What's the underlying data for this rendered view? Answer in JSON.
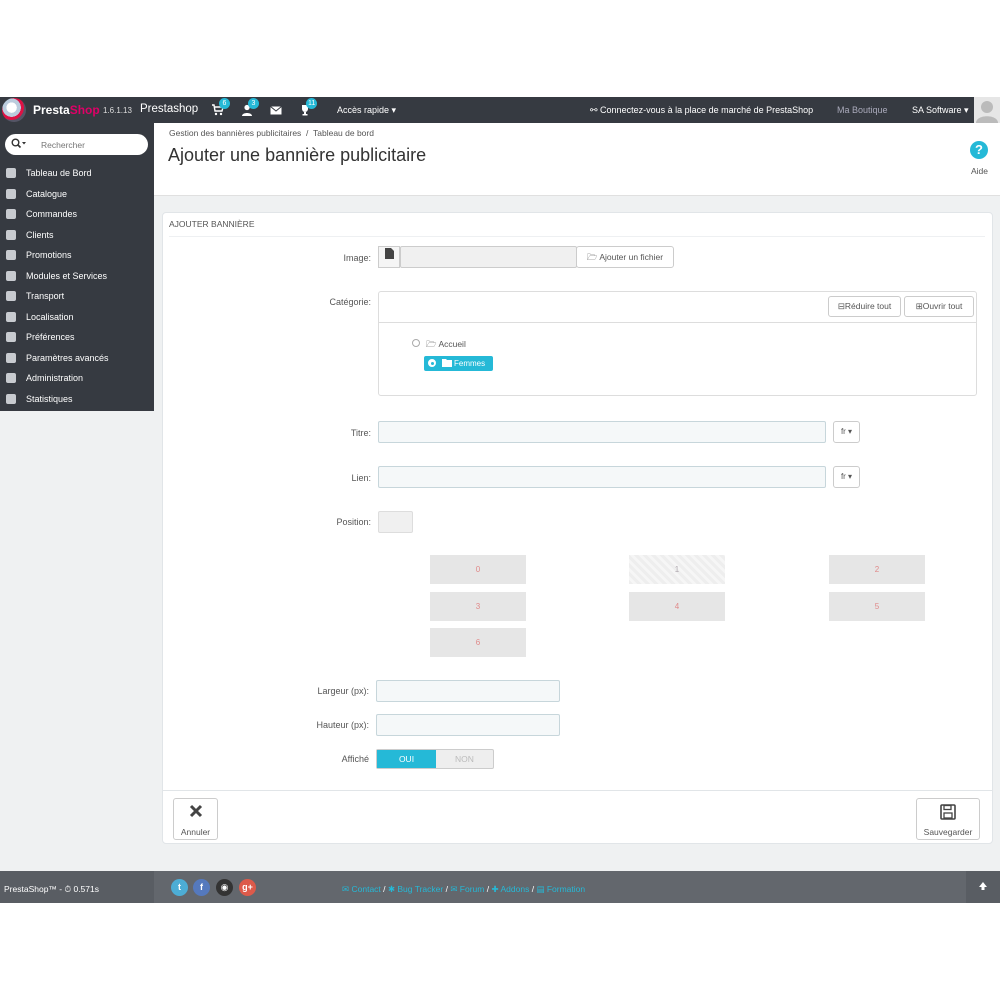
{
  "header": {
    "brand_presta": "Presta",
    "brand_shop": "Shop",
    "version": "1.6.1.13",
    "shop_name": "Prestashop",
    "orders_badge": "6",
    "customers_badge": "3",
    "trophy_badge": "11",
    "quick_access": "Accès rapide ▾",
    "marketplace": "Connectez-vous à la place de marché de PrestaShop",
    "my_shop": "Ma Boutique",
    "user": "SA Software ▾"
  },
  "sidebar": {
    "search_placeholder": "Rechercher",
    "items": [
      {
        "label": "Tableau de Bord"
      },
      {
        "label": "Catalogue"
      },
      {
        "label": "Commandes"
      },
      {
        "label": "Clients"
      },
      {
        "label": "Promotions"
      },
      {
        "label": "Modules et Services"
      },
      {
        "label": "Transport"
      },
      {
        "label": "Localisation"
      },
      {
        "label": "Préférences"
      },
      {
        "label": "Paramètres avancés"
      },
      {
        "label": "Administration"
      },
      {
        "label": "Statistiques"
      }
    ]
  },
  "page": {
    "breadcrumb_1": "Gestion des bannières publicitaires",
    "breadcrumb_sep": "/",
    "breadcrumb_2": "Tableau de bord",
    "title": "Ajouter une bannière publicitaire",
    "help_label": "Aide"
  },
  "form": {
    "panel_title": "AJOUTER BANNIÈRE",
    "image_label": "Image:",
    "add_file": "Ajouter un fichier",
    "category_label": "Catégorie:",
    "collapse_all": "Réduire tout",
    "expand_all": "Ouvrir tout",
    "tree": {
      "root": "Accueil",
      "child": "Femmes"
    },
    "title_label": "Titre:",
    "link_label": "Lien:",
    "lang": "fr ▾",
    "position_label": "Position:",
    "positions": [
      "0",
      "1",
      "2",
      "3",
      "4",
      "5",
      "6"
    ],
    "selected_position": "1",
    "width_label": "Largeur (px):",
    "height_label": "Hauteur (px):",
    "displayed_label": "Affiché",
    "toggle_on": "OUI",
    "toggle_off": "NON",
    "cancel": "Annuler",
    "save": "Sauvegarder"
  },
  "footer": {
    "text": "PrestaShop™ - ⏱ 0.571s",
    "links": [
      "Contact",
      "Bug Tracker",
      "Forum",
      "Addons",
      "Formation"
    ]
  },
  "colors": {
    "accent": "#25b9d7",
    "header_bg": "#363a41",
    "brand": "#df0067"
  }
}
